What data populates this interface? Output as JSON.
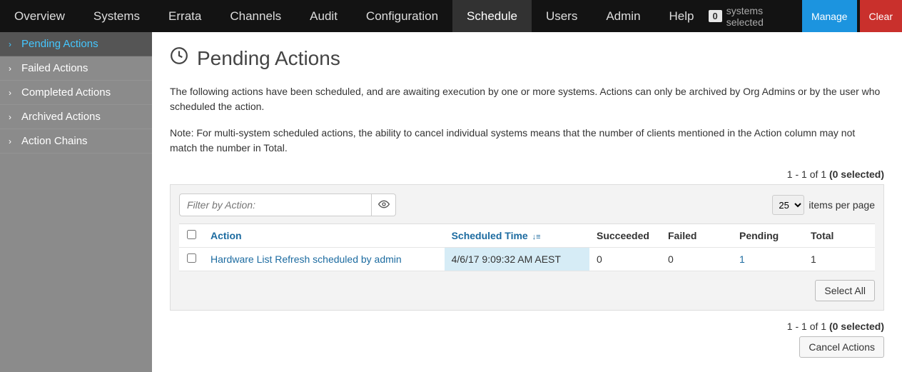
{
  "topnav": {
    "items": [
      "Overview",
      "Systems",
      "Errata",
      "Channels",
      "Audit",
      "Configuration",
      "Schedule",
      "Users",
      "Admin",
      "Help"
    ],
    "active_index": 6,
    "systems_selected_count": "0",
    "systems_selected_label": "systems selected",
    "manage_label": "Manage",
    "clear_label": "Clear"
  },
  "sidebar": {
    "items": [
      "Pending Actions",
      "Failed Actions",
      "Completed Actions",
      "Archived Actions",
      "Action Chains"
    ],
    "active_index": 0
  },
  "page": {
    "title": "Pending Actions",
    "para1": "The following actions have been scheduled, and are awaiting execution by one or more systems. Actions can only be archived by Org Admins or by the user who scheduled the action.",
    "para2": "Note: For multi-system scheduled actions, the ability to cancel individual systems means that the number of clients mentioned in the Action column may not match the number in Total."
  },
  "list": {
    "range_text": "1 - 1 of 1 ",
    "selected_text": "(0 selected)",
    "filter_placeholder": "Filter by Action:",
    "items_per_page_value": "25",
    "items_per_page_label": "items per page",
    "columns": {
      "action": "Action",
      "scheduled_time": "Scheduled Time",
      "succeeded": "Succeeded",
      "failed": "Failed",
      "pending": "Pending",
      "total": "Total"
    },
    "rows": [
      {
        "action": "Hardware List Refresh scheduled by admin",
        "scheduled_time": "4/6/17 9:09:32 AM AEST",
        "succeeded": "0",
        "failed": "0",
        "pending": "1",
        "total": "1"
      }
    ],
    "select_all_label": "Select All",
    "cancel_actions_label": "Cancel Actions"
  }
}
